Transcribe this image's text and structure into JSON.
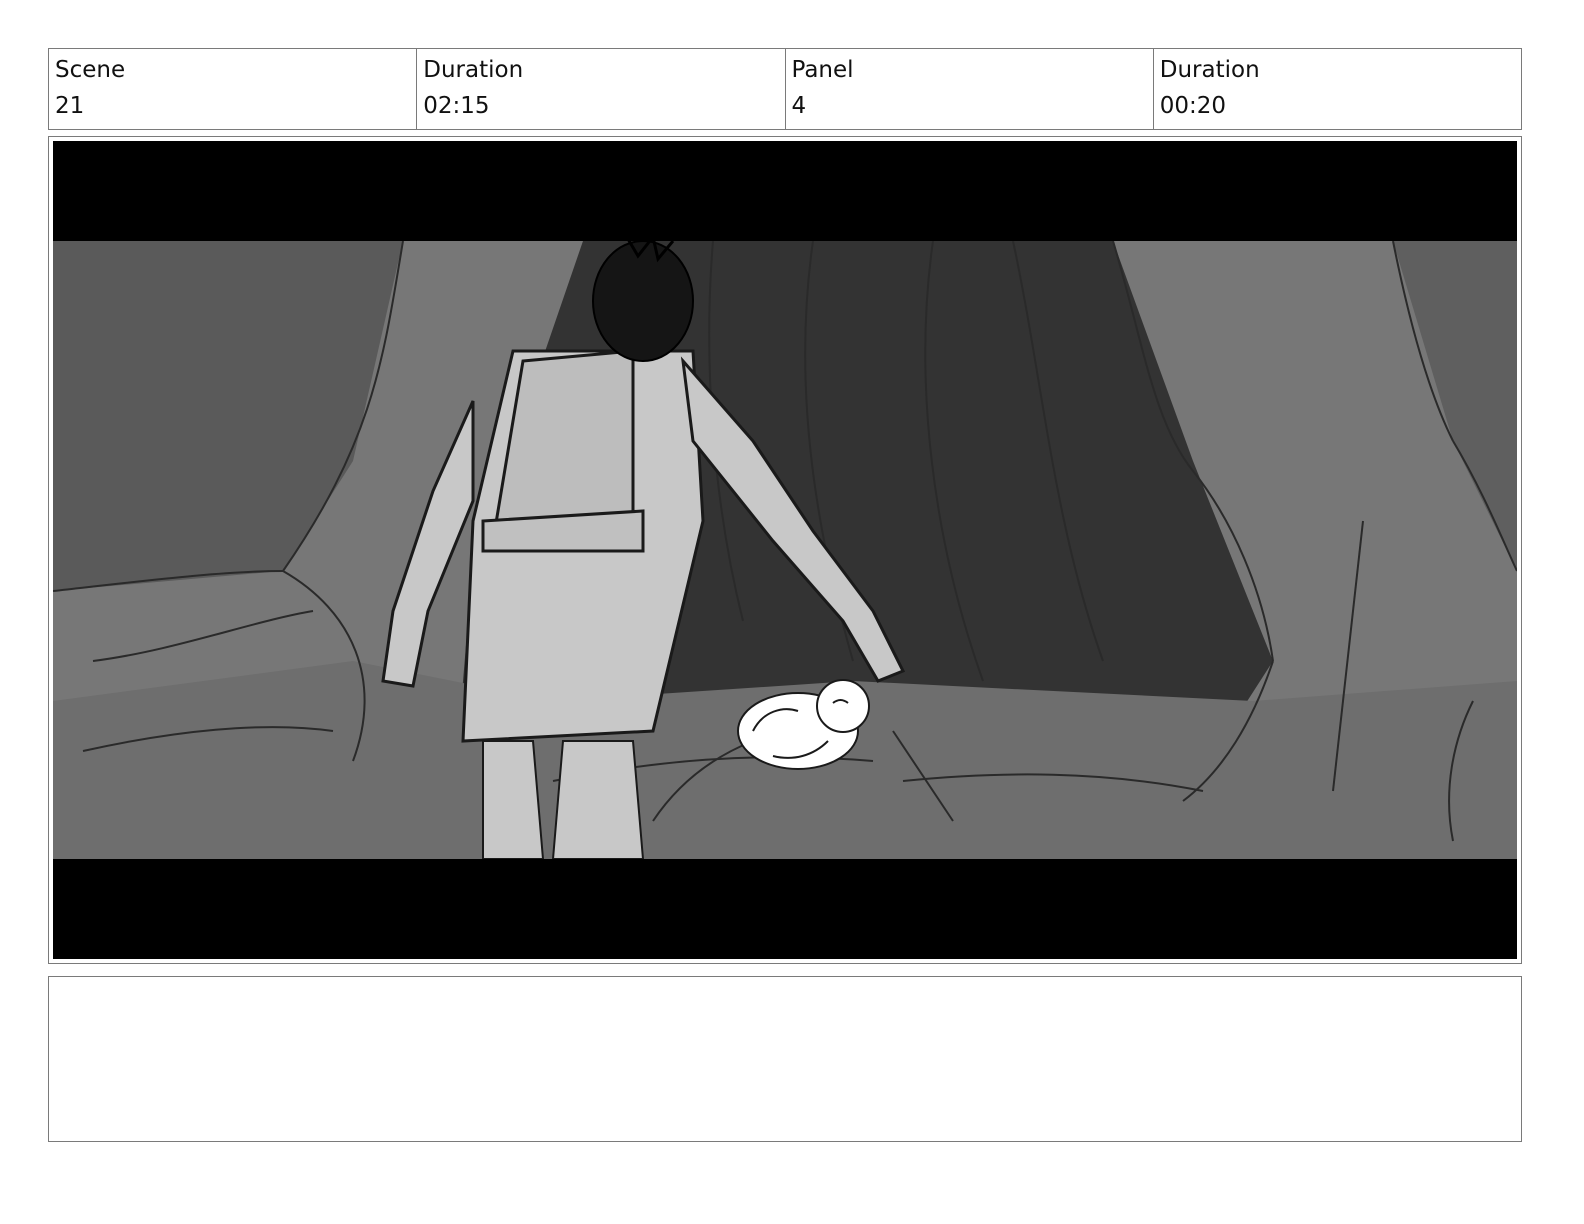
{
  "header": {
    "scene_label": "Scene",
    "scene_value": "21",
    "scene_duration_label": "Duration",
    "scene_duration_value": "02:15",
    "panel_label": "Panel",
    "panel_value": "4",
    "panel_duration_label": "Duration",
    "panel_duration_value": "00:20"
  },
  "panel": {
    "letterbox_color": "#000000",
    "background_gray": "#7a7a7a",
    "shadow_gray": "#3a3a3a",
    "figure_gray": "#c8c8c8",
    "baby_color": "#ffffff"
  },
  "notes": {
    "text": ""
  }
}
